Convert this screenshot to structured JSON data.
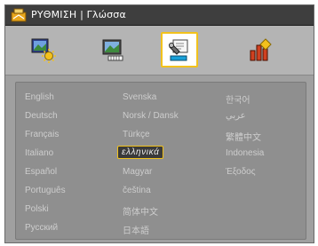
{
  "title": "ΡΥΘΜΙΣΗ | Γλώσσα",
  "tabs": [
    {
      "icon": "image-settings-icon"
    },
    {
      "icon": "display-settings-icon"
    },
    {
      "icon": "setup-settings-icon",
      "active": true
    },
    {
      "icon": "options-settings-icon"
    }
  ],
  "languages": {
    "col1": [
      "English",
      "Deutsch",
      "Français",
      "Italiano",
      "Español",
      "Português",
      "Polski",
      "Русский"
    ],
    "col2": [
      "Svenska",
      "Norsk / Dansk",
      "Türkçe",
      "ελληνικά",
      "Magyar",
      "čeština",
      "简体中文",
      "日本語"
    ],
    "col3": [
      "한국어",
      "عربي",
      "繁體中文",
      "Indonesia",
      "Έξοδος"
    ]
  },
  "selected_language": "ελληνικά",
  "colors": {
    "highlight": "#f2c21c",
    "background": "#a0a0a0",
    "panel": "#8f8f8f",
    "title_bar": "#3e3e3e"
  }
}
